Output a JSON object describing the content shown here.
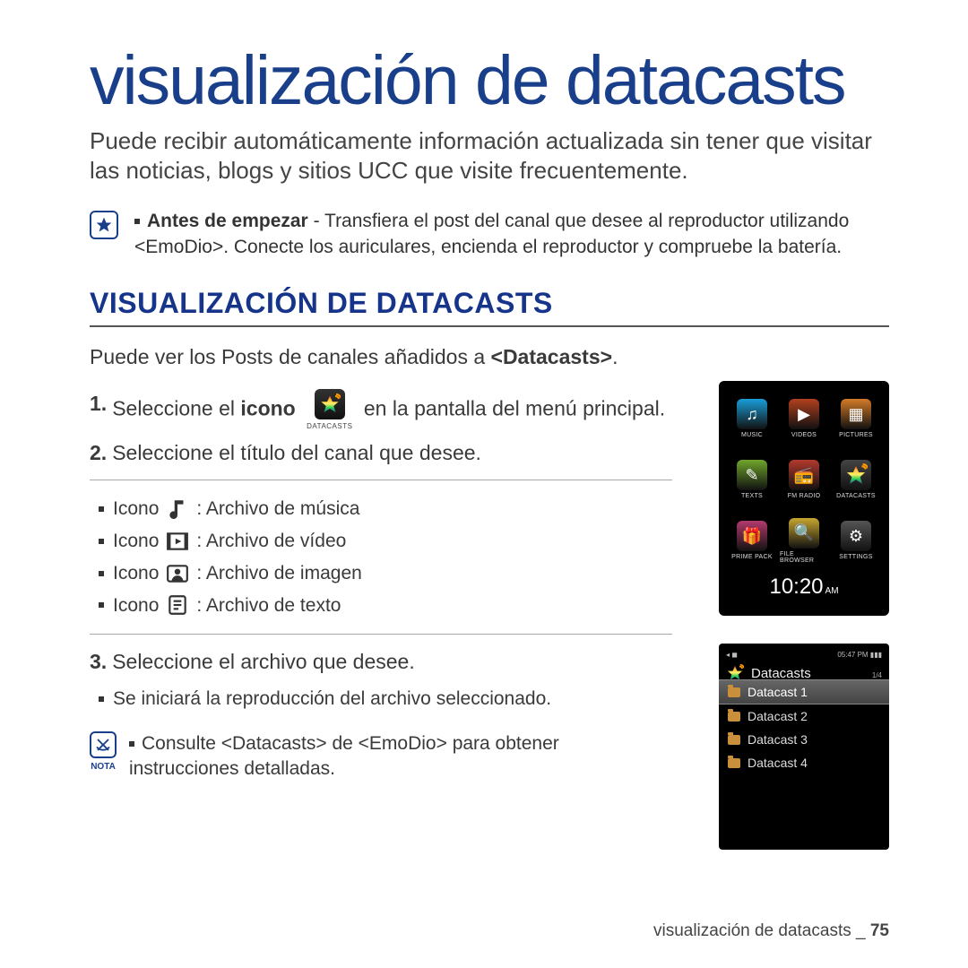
{
  "title": "visualización de datacasts",
  "intro": "Puede recibir automáticamente información actualizada sin tener que visitar las noticias, blogs y sitios UCC que visite frecuentemente.",
  "tip": {
    "bold": "Antes de empezar",
    "rest": " - Transfiera el post del canal que desee al reproductor utilizando <EmoDio>. Conecte los auriculares, encienda el reproductor y compruebe la batería."
  },
  "section_heading": "VISUALIZACIÓN DE DATACASTS",
  "sub_pre": "Puede ver los Posts de canales añadidos a ",
  "sub_bold": "<Datacasts>",
  "sub_post": ".",
  "step1_pre": "Seleccione el ",
  "step1_bold": "icono",
  "step1_post": " en la pantalla del menú principal.",
  "inline_icon_cap": "DATACASTS",
  "step2": "Seleccione el título del canal que desee.",
  "icons": {
    "lead": "Icono",
    "music": ": Archivo de música",
    "video": ": Archivo de vídeo",
    "image": ": Archivo de imagen",
    "text": ": Archivo de texto"
  },
  "step3": "Seleccione el archivo que desee.",
  "step3_sub": "Se iniciará la reproducción del archivo seleccionado.",
  "note_cap": "NOTA",
  "note_text": "Consulte <Datacasts> de <EmoDio> para obtener instrucciones detalladas.",
  "device1": {
    "apps": [
      {
        "label": "MUSIC",
        "color": "#1a9dd8"
      },
      {
        "label": "VIDEOS",
        "color": "#b2401e"
      },
      {
        "label": "PICTURES",
        "color": "#d37b27"
      },
      {
        "label": "TEXTS",
        "color": "#6fa52b"
      },
      {
        "label": "FM RADIO",
        "color": "#b33a2d"
      },
      {
        "label": "DATACASTS",
        "color": "#333"
      },
      {
        "label": "PRIME PACK",
        "color": "#b23a6d"
      },
      {
        "label": "FILE BROWSER",
        "color": "#c7a62f"
      },
      {
        "label": "SETTINGS",
        "color": "#555"
      }
    ],
    "clock": "10:20",
    "ampm": "AM"
  },
  "device2": {
    "status_left": "◂ ◼",
    "status_right": "05:47 PM ▮▮▮",
    "title": "Datacasts",
    "page": "1/4",
    "items": [
      "Datacast 1",
      "Datacast 2",
      "Datacast 3",
      "Datacast 4"
    ],
    "selected": 0
  },
  "footer_text": "visualización de datacasts _ ",
  "footer_page": "75"
}
